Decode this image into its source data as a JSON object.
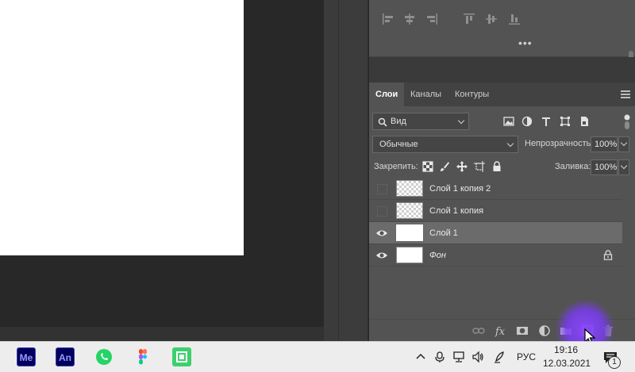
{
  "layers_panel": {
    "tabs": [
      {
        "label": "Слои",
        "active": true
      },
      {
        "label": "Каналы",
        "active": false
      },
      {
        "label": "Контуры",
        "active": false
      }
    ],
    "filter": {
      "label": "Вид"
    },
    "blend_mode": "Обычные",
    "opacity_label": "Непрозрачность:",
    "opacity_value": "100%",
    "lock_label": "Закрепить:",
    "fill_label": "Заливка:",
    "fill_value": "100%",
    "layers": [
      {
        "name": "Слой 1 копия 2",
        "visible": false,
        "selected": false,
        "thumb": "transparent"
      },
      {
        "name": "Слой 1 копия",
        "visible": false,
        "selected": false,
        "thumb": "transparent"
      },
      {
        "name": "Слой 1",
        "visible": true,
        "selected": true,
        "thumb": "white"
      },
      {
        "name": "Фон",
        "visible": true,
        "selected": false,
        "thumb": "white",
        "italic": true,
        "locked": true
      }
    ]
  },
  "taskbar": {
    "apps": [
      {
        "label": "Me",
        "name": "media-encoder",
        "bg": "#00005b",
        "fg": "#9999ff"
      },
      {
        "label": "An",
        "name": "animate",
        "bg": "#00005b",
        "fg": "#9999ff"
      },
      {
        "label": "",
        "name": "whatsapp",
        "bg": "#25d366"
      },
      {
        "label": "",
        "name": "figma",
        "bg": "#ededed"
      },
      {
        "label": "",
        "name": "greenshot",
        "bg": "#3ecf6e"
      }
    ],
    "language": "РУС",
    "time": "19:16",
    "date": "12.03.2021",
    "notifications": "1"
  },
  "colors": {
    "panel_bg": "#535353",
    "selected_row": "#6b6b6b",
    "click_highlight": "#7c3cf0"
  }
}
